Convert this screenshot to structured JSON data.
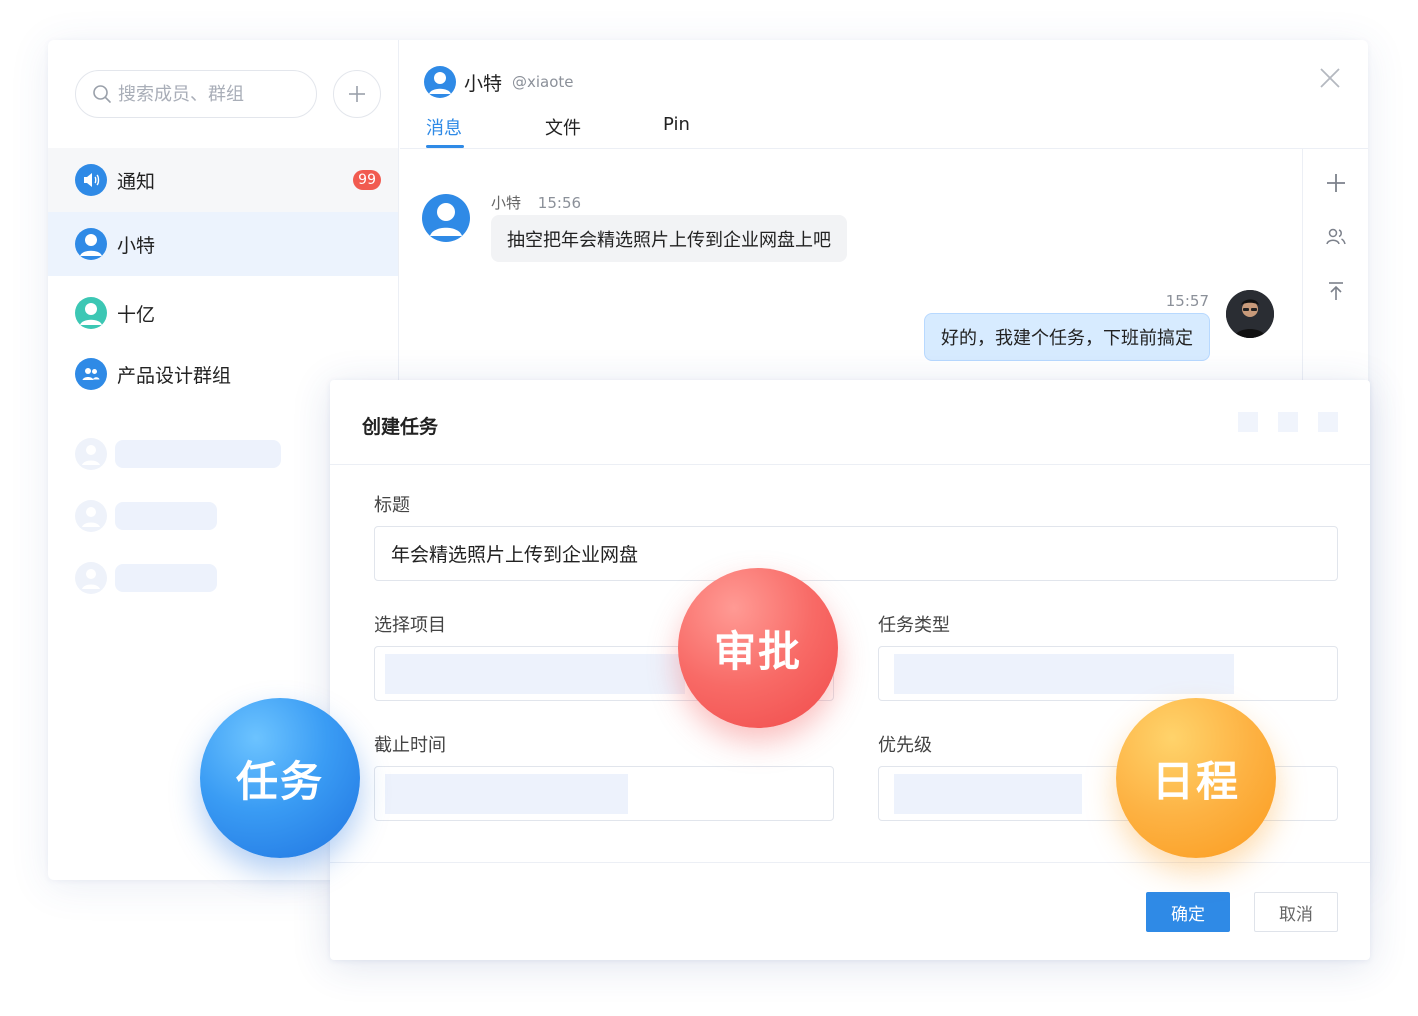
{
  "sidebar": {
    "search_placeholder": "搜索成员、群组",
    "items": [
      {
        "label": "通知",
        "badge": "99",
        "icon": "speaker-icon",
        "color": "#2f8ae6"
      },
      {
        "label": "小特",
        "icon": "user-avatar-icon",
        "color": "#2f8ae6",
        "selected": true
      },
      {
        "label": "十亿",
        "icon": "user-avatar-icon",
        "color": "#3cc7b4"
      },
      {
        "label": "产品设计群组",
        "icon": "group-icon",
        "color": "#2f8ae6"
      }
    ]
  },
  "chat": {
    "user_name": "小特",
    "user_handle": "@xiaote",
    "tabs": [
      "消息",
      "文件",
      "Pin"
    ],
    "active_tab": "消息",
    "messages": [
      {
        "sender": "小特",
        "time": "15:56",
        "text": "抽空把年会精选照片上传到企业网盘上吧",
        "side": "left"
      },
      {
        "time": "15:57",
        "text": "好的，我建个任务，下班前搞定",
        "side": "right"
      }
    ],
    "tools": [
      "plus-icon",
      "contacts-icon",
      "pin-top-icon"
    ]
  },
  "dialog": {
    "title": "创建任务",
    "fields": {
      "title_label": "标题",
      "title_value": "年会精选照片上传到企业网盘",
      "project_label": "选择项目",
      "type_label": "任务类型",
      "deadline_label": "截止时间",
      "priority_label": "优先级"
    },
    "confirm": "确定",
    "cancel": "取消"
  },
  "features": {
    "task": "任务",
    "approve": "审批",
    "schedule": "日程"
  },
  "colors": {
    "accent": "#2f8ae6",
    "badge": "#f15b50",
    "task": "#2f8ae6",
    "approve": "#f45656",
    "schedule": "#fca52d"
  }
}
